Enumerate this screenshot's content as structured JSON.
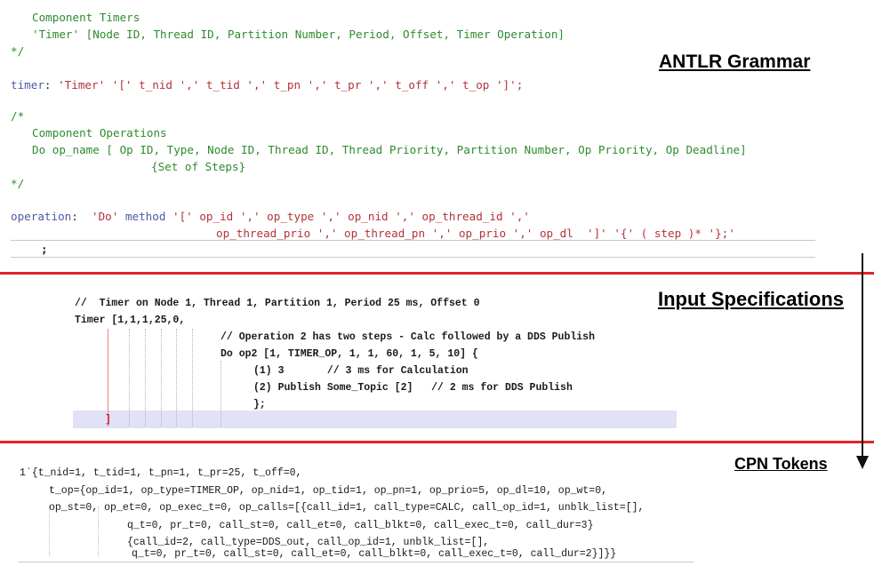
{
  "sections": {
    "grammar": {
      "heading": "ANTLR Grammar"
    },
    "input": {
      "heading": "Input Specifications"
    },
    "tokens": {
      "heading": "CPN Tokens"
    }
  },
  "grammar_code": {
    "l1": "Component Timers",
    "l2": "'Timer' [Node ID, Thread ID, Partition Number, Period, Offset, Timer Operation]",
    "l3": "*/",
    "timer_kw": "timer",
    "timer_colon": ": ",
    "timer_str1": "'Timer'",
    "timer_sp": " ",
    "timer_str2": "'['",
    "timer_rest": " t_nid ',' t_tid ',' t_pn ',' t_pr ',' t_off ',' t_op ']';",
    "l5": "/*",
    "l6": "Component Operations",
    "l7": "Do op_name [ Op ID, Type, Node ID, Thread ID, Thread Priority, Partition Number, Op Priority, Op Deadline]",
    "l8": "{Set of Steps}",
    "l9": "*/",
    "op_kw": "operation",
    "op_colon": ":  ",
    "op_str": "'Do'",
    "op_method": " method ",
    "op_rest1": "'[' op_id ',' op_type ',' op_nid ',' op_thread_id ','",
    "op_rest2": "op_thread_prio ',' op_thread_pn ',' op_prio ',' op_dl  ']' '{' ( step )* '};'",
    "l12": ";"
  },
  "input_code": {
    "l1": "//  Timer on Node 1, Thread 1, Partition 1, Period 25 ms, Offset 0",
    "l2": "Timer [1,1,1,25,0,",
    "l3": "// Operation 2 has two steps - Calc followed by a DDS Publish",
    "l4": "Do op2 [1, TIMER_OP, 1, 1, 60, 1, 5, 10] {",
    "l5": "(1) 3       // 3 ms for Calculation",
    "l6": "(2) Publish Some_Topic [2]   // 2 ms for DDS Publish",
    "l7": "};",
    "l8": "]"
  },
  "token_code": {
    "l1": "1`{t_nid=1, t_tid=1, t_pn=1, t_pr=25, t_off=0,",
    "l2": "t_op={op_id=1, op_type=TIMER_OP, op_nid=1, op_tid=1, op_pn=1, op_prio=5, op_dl=10, op_wt=0,",
    "l3": "op_st=0, op_et=0, op_exec_t=0, op_calls=[{call_id=1, call_type=CALC, call_op_id=1, unblk_list=[],",
    "l4": "q_t=0, pr_t=0, call_st=0, call_et=0, call_blkt=0, call_exec_t=0, call_dur=3}",
    "l5": "{call_id=2, call_type=DDS_out, call_op_id=1, unblk_list=[],",
    "l6": "q_t=0, pr_t=0, call_st=0, call_et=0, call_blkt=0, call_exec_t=0, call_dur=2}]}}"
  }
}
